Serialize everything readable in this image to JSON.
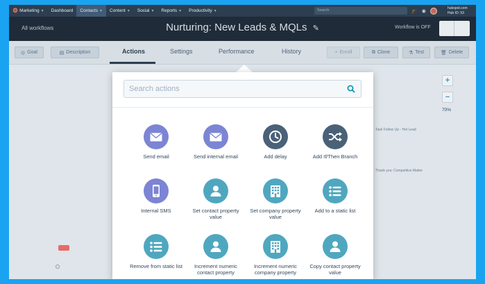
{
  "colors": {
    "frame_border": "#1aa3f0",
    "nav_bg": "#2d3e50",
    "header_bg": "#1f2b38",
    "purple_icon": "#7c84d4",
    "dark_icon": "#4a6178",
    "teal_icon": "#4fa7bf",
    "hubspot_orange": "#ff7a59"
  },
  "nav": {
    "items": [
      {
        "label": "Marketing",
        "dropdown": true
      },
      {
        "label": "Dashboard",
        "dropdown": false
      },
      {
        "label": "Contacts",
        "dropdown": true
      },
      {
        "label": "Content",
        "dropdown": true
      },
      {
        "label": "Social",
        "dropdown": true
      },
      {
        "label": "Reports",
        "dropdown": true
      },
      {
        "label": "Productivity",
        "dropdown": true
      }
    ],
    "search_placeholder": "Search",
    "account_domain": "hubspot.com",
    "hub_id": "Hub ID: 53"
  },
  "header": {
    "back_link": "All workflows",
    "title": "Nurturing: New Leads & MQLs",
    "status": "Workflow is OFF"
  },
  "toolbar": {
    "goal": "Goal",
    "description": "Description",
    "tabs": [
      "Actions",
      "Settings",
      "Performance",
      "History"
    ],
    "active_tab": "Actions",
    "enroll": "Enroll",
    "clone": "Clone",
    "test": "Test",
    "delete": "Delete"
  },
  "canvas": {
    "bg_text_1": "Task Follow Up - Hot Lead",
    "bg_text_2": "Thank you: Competitive Matter",
    "zoom": "70%"
  },
  "popover": {
    "search_placeholder": "Search actions",
    "actions": [
      {
        "label": "Send email",
        "icon": "envelope-icon",
        "color": "purple"
      },
      {
        "label": "Send internal email",
        "icon": "envelope-icon",
        "color": "purple"
      },
      {
        "label": "Add delay",
        "icon": "clock-icon",
        "color": "dark"
      },
      {
        "label": "Add If/Then Branch",
        "icon": "shuffle-icon",
        "color": "dark"
      },
      {
        "label": "Internal SMS",
        "icon": "phone-icon",
        "color": "purple"
      },
      {
        "label": "Set contact property value",
        "icon": "person-icon",
        "color": "teal"
      },
      {
        "label": "Set company property value",
        "icon": "building-icon",
        "color": "teal"
      },
      {
        "label": "Add to a static list",
        "icon": "list-icon",
        "color": "teal"
      },
      {
        "label": "Remove from static list",
        "icon": "list-icon",
        "color": "teal"
      },
      {
        "label": "Increment numeric contact property",
        "icon": "person-icon",
        "color": "teal"
      },
      {
        "label": "Increment numeric company property",
        "icon": "building-icon",
        "color": "teal"
      },
      {
        "label": "Copy contact property value",
        "icon": "person-icon",
        "color": "teal"
      }
    ]
  }
}
